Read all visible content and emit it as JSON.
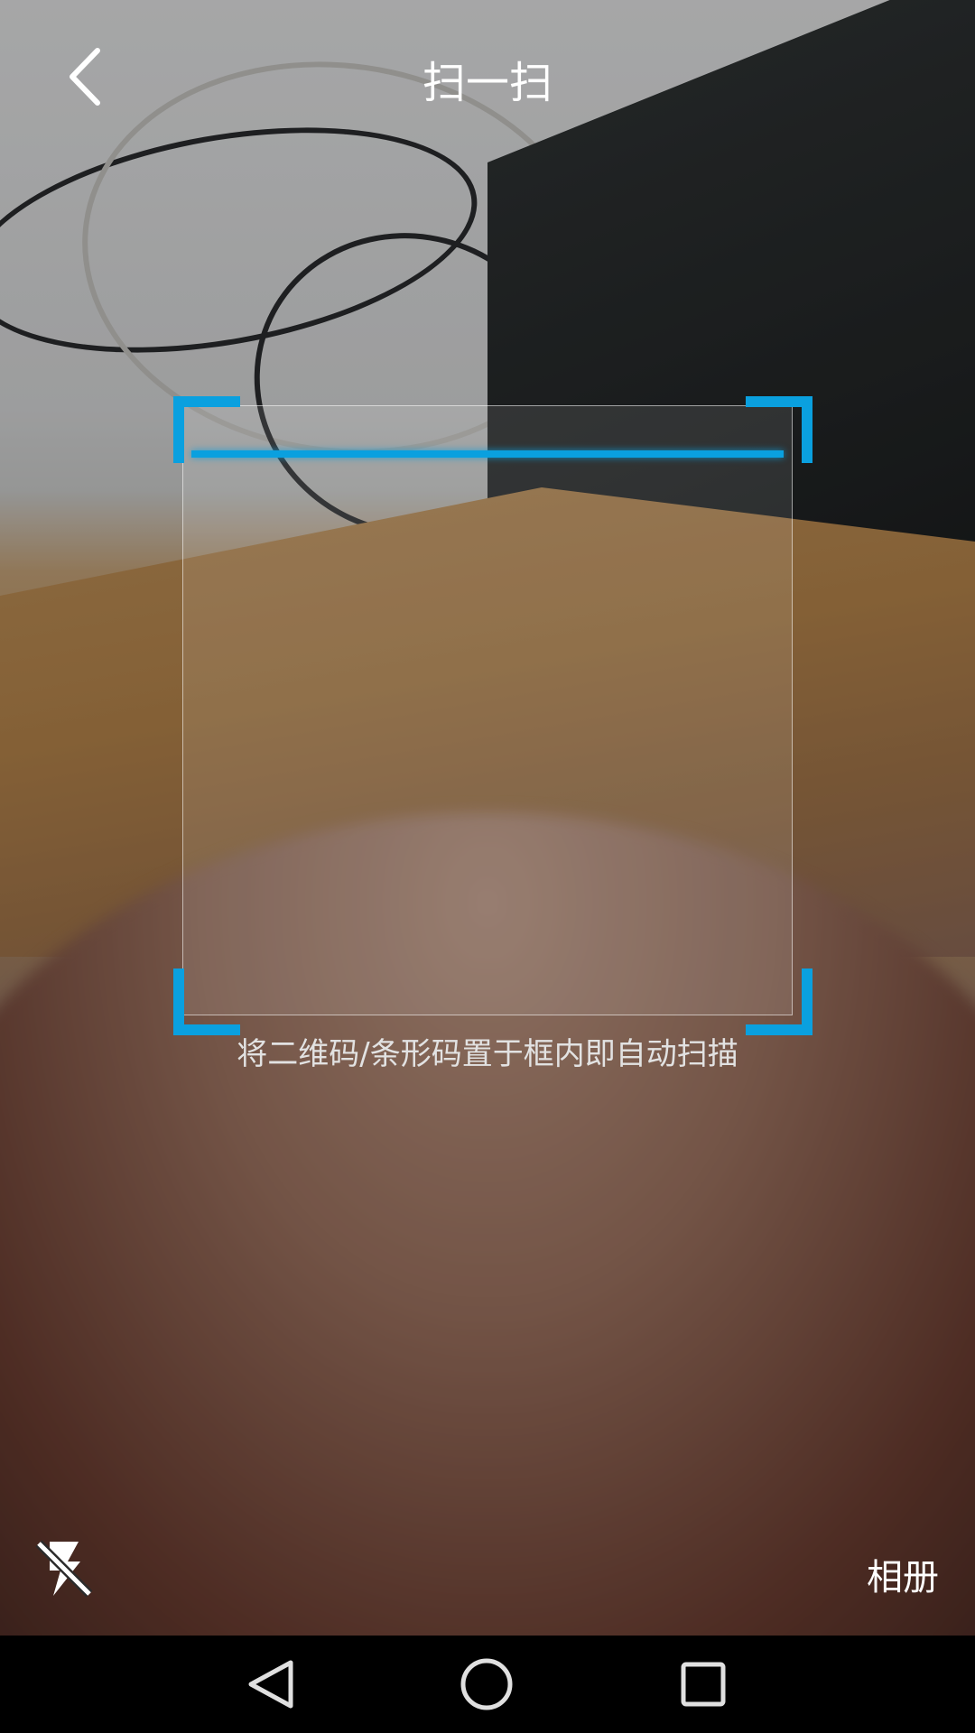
{
  "header": {
    "title": "扫一扫"
  },
  "scanner": {
    "hint": "将二维码/条形码置于框内即自动扫描"
  },
  "bottom": {
    "album_label": "相册"
  },
  "icons": {
    "back": "chevron-left-icon",
    "flash": "flash-off-icon",
    "nav_back": "triangle-back-icon",
    "nav_home": "circle-home-icon",
    "nav_recent": "square-recent-icon"
  },
  "colors": {
    "accent": "#0aa0df",
    "text": "#ffffff",
    "hint": "#e2e2e2"
  }
}
